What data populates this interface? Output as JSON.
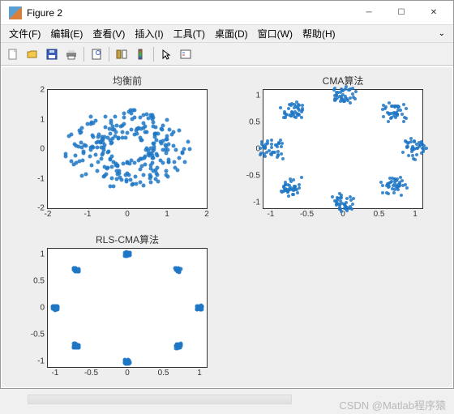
{
  "window": {
    "title": "Figure 2"
  },
  "menu": {
    "file": "文件(F)",
    "edit": "编辑(E)",
    "view": "查看(V)",
    "insert": "插入(I)",
    "tools": "工具(T)",
    "desktop": "桌面(D)",
    "window": "窗口(W)",
    "help": "帮助(H)"
  },
  "subplot1": {
    "title": "均衡前",
    "xticks": [
      "-2",
      "-1",
      "0",
      "1",
      "2"
    ],
    "yticks": [
      "-2",
      "-1",
      "0",
      "1",
      "2"
    ]
  },
  "subplot2": {
    "title": "CMA算法",
    "xticks": [
      "-1",
      "-0.5",
      "0",
      "0.5",
      "1"
    ],
    "yticks": [
      "-1",
      "-0.5",
      "0",
      "0.5",
      "1"
    ]
  },
  "subplot3": {
    "title": "RLS-CMA算法",
    "xticks": [
      "-1",
      "-0.5",
      "0",
      "0.5",
      "1"
    ],
    "yticks": [
      "-1",
      "-0.5",
      "0",
      "0.5",
      "1"
    ]
  },
  "chart_data": [
    {
      "type": "scatter",
      "title": "均衡前",
      "xlim": [
        -2,
        2
      ],
      "ylim": [
        -2,
        2
      ],
      "description": "dense annular/elliptical scatter of ~250 points, outer radius ≈1.4, inner hole radius ≈0.35, slightly wider than tall",
      "color": "#1f77c4"
    },
    {
      "type": "scatter",
      "title": "CMA算法",
      "xlim": [
        -1.1,
        1.1
      ],
      "ylim": [
        -1.1,
        1.1
      ],
      "series": [
        {
          "name": "cluster-centers",
          "values": [
            [
              -1.0,
              0.0
            ],
            [
              -0.707,
              0.707
            ],
            [
              0.0,
              1.0
            ],
            [
              0.707,
              0.707
            ],
            [
              1.0,
              0.0
            ],
            [
              0.707,
              -0.707
            ],
            [
              0.0,
              -1.0
            ],
            [
              -0.707,
              -0.707
            ]
          ]
        }
      ],
      "cluster_spread": 0.1,
      "points_per_cluster": 40,
      "color": "#1f77c4"
    },
    {
      "type": "scatter",
      "title": "RLS-CMA算法",
      "xlim": [
        -1.1,
        1.1
      ],
      "ylim": [
        -1.1,
        1.1
      ],
      "series": [
        {
          "name": "cluster-centers",
          "values": [
            [
              -1.0,
              0.0
            ],
            [
              -0.707,
              0.707
            ],
            [
              0.0,
              1.0
            ],
            [
              0.707,
              0.707
            ],
            [
              1.0,
              0.0
            ],
            [
              0.707,
              -0.707
            ],
            [
              0.0,
              -1.0
            ],
            [
              -0.707,
              -0.707
            ]
          ]
        }
      ],
      "cluster_spread": 0.04,
      "points_per_cluster": 25,
      "color": "#1f77c4"
    }
  ],
  "watermark": "CSDN @Matlab程序猿"
}
